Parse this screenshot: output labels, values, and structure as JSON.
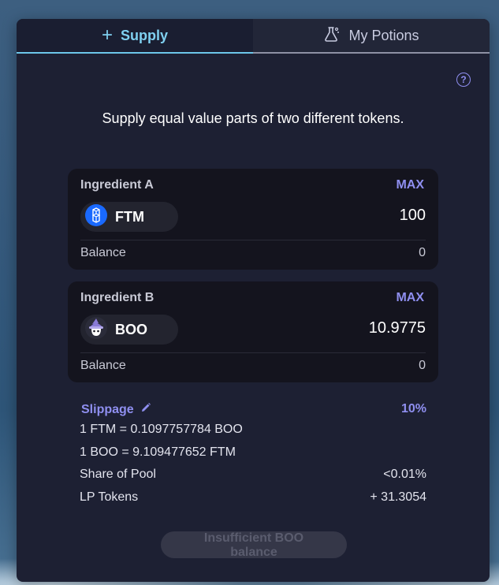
{
  "tabs": {
    "supply_label": "Supply",
    "potions_label": "My Potions"
  },
  "help_glyph": "?",
  "subtitle": "Supply equal value parts of two different tokens.",
  "ingredient_a": {
    "title": "Ingredient A",
    "max_label": "MAX",
    "token": "FTM",
    "token_icon": "fantom-icon",
    "amount": "100",
    "balance_label": "Balance",
    "balance_value": "0"
  },
  "ingredient_b": {
    "title": "Ingredient B",
    "max_label": "MAX",
    "token": "BOO",
    "token_icon": "boo-ghost-icon",
    "amount": "10.9775",
    "balance_label": "Balance",
    "balance_value": "0"
  },
  "slippage": {
    "label": "Slippage",
    "value": "10%"
  },
  "rates": {
    "ftm_to_boo": "1 FTM = 0.1097757784 BOO",
    "boo_to_ftm": "1 BOO = 9.109477652 FTM"
  },
  "share_of_pool": {
    "label": "Share of Pool",
    "value": "<0.01%"
  },
  "lp_tokens": {
    "label": "LP Tokens",
    "value": "+ 31.3054"
  },
  "action_button": {
    "line1": "Insufficient BOO",
    "line2": "balance"
  },
  "colors": {
    "accent": "#8f8ff0",
    "tab_active": "#7fd0f0",
    "panel_bg": "#1d2033",
    "card_bg": "#14141e"
  }
}
